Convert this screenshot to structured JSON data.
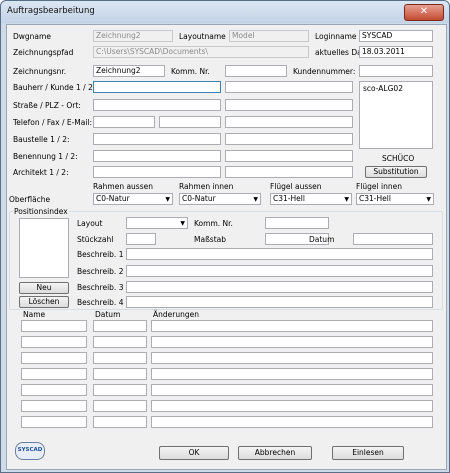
{
  "window": {
    "title": "Auftragsbearbeitung",
    "close_symbol": "✕"
  },
  "header": {
    "dwgname_label": "Dwgname",
    "dwgname_value": "Zeichnung2",
    "layoutname_label": "Layoutname",
    "layoutname_value": "Model",
    "loginname_label": "Loginname",
    "loginname_value": "SYSCAD",
    "pfad_label": "Zeichnungspfad",
    "pfad_value": "C:\\Users\\SYSCAD\\Documents\\",
    "datum_label": "aktuelles Datum",
    "datum_value": "18.03.2011",
    "zeichnr_label": "Zeichnungsnr.",
    "zeichnr_value": "Zeichnung2",
    "kommnr_label": "Komm. Nr.",
    "kommnr_value": "",
    "kundennr_label": "Kundennummer:",
    "kundennr_value": ""
  },
  "address": {
    "bauherr_label": "Bauherr / Kunde 1 / 2:",
    "strasse_label": "Straße / PLZ - Ort:",
    "telefon_label": "Telefon / Fax / E-Mail:",
    "baustelle_label": "Baustelle 1 / 2:",
    "benennung_label": "Benennung 1 / 2:",
    "architekt_label": "Architekt 1 / 2:"
  },
  "system": {
    "list_item": "sco-ALG02",
    "brand": "SCHÜCO",
    "substitution_button": "Substitution"
  },
  "oberflaeche": {
    "label": "Oberfläche",
    "rahmen_aussen_label": "Rahmen aussen",
    "rahmen_aussen_value": "C0-Natur",
    "rahmen_innen_label": "Rahmen innen",
    "rahmen_innen_value": "C0-Natur",
    "fluegel_aussen_label": "Flügel aussen",
    "fluegel_aussen_value": "C31-Hell",
    "fluegel_innen_label": "Flügel innen",
    "fluegel_innen_value": "C31-Hell"
  },
  "position": {
    "group_label": "Positionsindex",
    "neu_button": "Neu",
    "loeschen_button": "Löschen",
    "layout_label": "Layout",
    "kommnr_label": "Komm. Nr.",
    "stueckzahl_label": "Stückzahl",
    "massstab_label": "Maßstab",
    "datum_label": "Datum",
    "beschreib1_label": "Beschreib. 1",
    "beschreib2_label": "Beschreib. 2",
    "beschreib3_label": "Beschreib. 3",
    "beschreib4_label": "Beschreib. 4"
  },
  "changes": {
    "col_name": "Name",
    "col_datum": "Datum",
    "col_aenderungen": "Änderungen"
  },
  "footer": {
    "logo_text": "SYSCAD",
    "ok_button": "OK",
    "abbrechen_button": "Abbrechen",
    "einlesen_button": "Einlesen"
  }
}
